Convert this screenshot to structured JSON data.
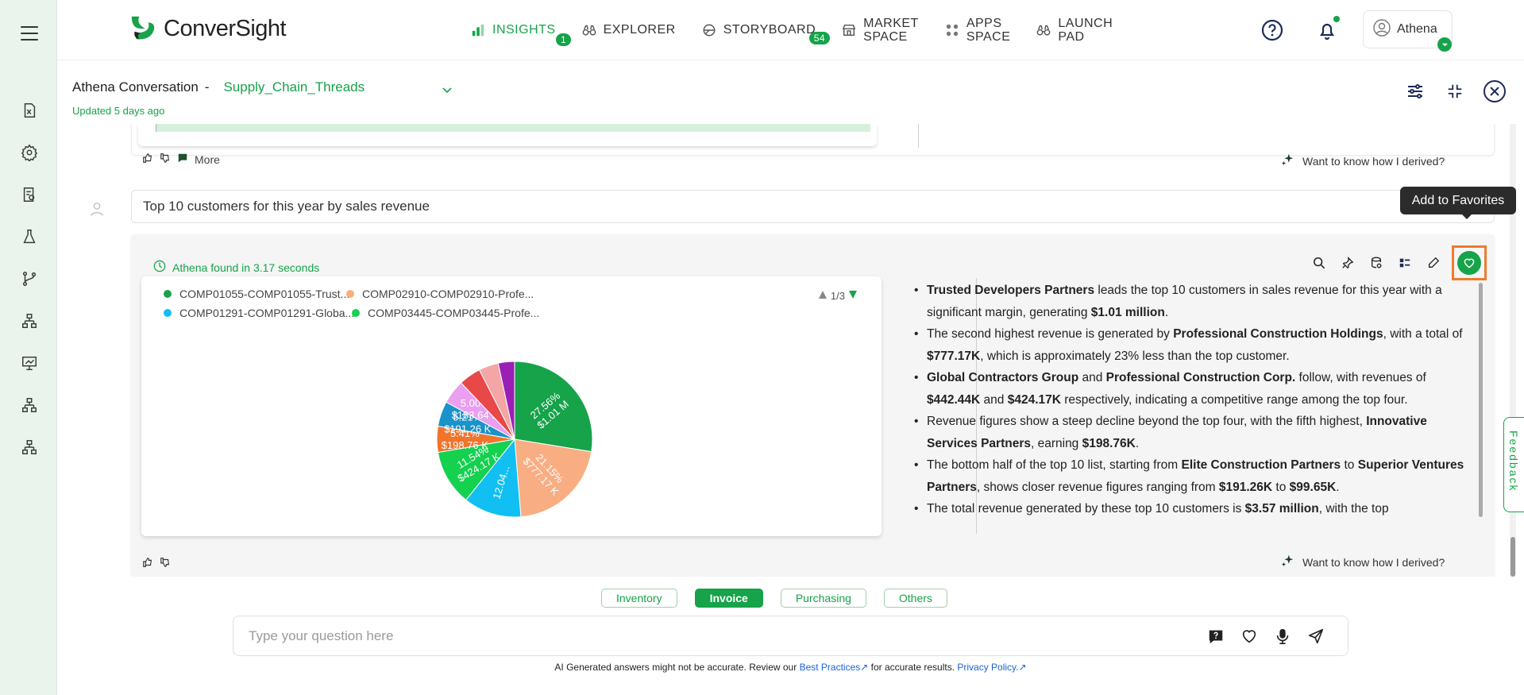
{
  "app": {
    "brand": "ConverSight"
  },
  "nav": [
    {
      "label": "INSIGHTS",
      "badge": "1",
      "active": true,
      "icon": "bar-chart-icon"
    },
    {
      "label": "EXPLORER",
      "badge": "",
      "active": false,
      "icon": "binoculars-icon"
    },
    {
      "label": "STORYBOARD",
      "badge": "54",
      "active": false,
      "icon": "palette-icon"
    },
    {
      "label_line1": "MARKET",
      "label_line2": "SPACE",
      "active": false,
      "icon": "store-icon"
    },
    {
      "label_line1": "APPS",
      "label_line2": "SPACE",
      "active": false,
      "icon": "apps-icon"
    },
    {
      "label_line1": "LAUNCH",
      "label_line2": "PAD",
      "active": false,
      "icon": "rocket-icon"
    }
  ],
  "user": {
    "name": "Athena"
  },
  "conversation": {
    "title": "Athena Conversation",
    "separator": "-",
    "dataset": "Supply_Chain_Threads",
    "updated": "Updated 5 days ago"
  },
  "previous_answer": {
    "more_label": "More",
    "derive_label": "Want to know how I derived?"
  },
  "question": {
    "text": "Top 10 customers for this year by sales revenue"
  },
  "answer": {
    "found_text": "Athena found in 3.17 seconds",
    "tooltip": "Add to Favorites",
    "legend_pager": "1/3",
    "derive_label": "Want to know how I derived?"
  },
  "chart_data": {
    "type": "pie",
    "legend_visible": [
      {
        "label": "COMP01055-COMP01055-Trust...",
        "color": "#16a34a"
      },
      {
        "label": "COMP02910-COMP02910-Profe...",
        "color": "#f9ad82"
      },
      {
        "label": "COMP01291-COMP01291-Globa...",
        "color": "#12bff2"
      },
      {
        "label": "COMP03445-COMP03445-Profe...",
        "color": "#14d14f"
      }
    ],
    "slices": [
      {
        "percent": 27.56,
        "value_label": "$1.01 M",
        "pct_label": "27.56%",
        "color": "#16a34a"
      },
      {
        "percent": 21.15,
        "value_label": "$777.17 K",
        "pct_label": "21.15%",
        "color": "#f9ad82"
      },
      {
        "percent": 12.04,
        "value_label": "",
        "pct_label": "12.04...",
        "color": "#12bff2"
      },
      {
        "percent": 11.54,
        "value_label": "$424.17 K",
        "pct_label": "11.54%",
        "color": "#14d14f"
      },
      {
        "percent": 5.41,
        "value_label": "$198.76 K",
        "pct_label": "5.41%",
        "color": "#f0742b"
      },
      {
        "percent": 5.21,
        "value_label": "$191.26 K",
        "pct_label": "5.21%",
        "color": "#1993c9"
      },
      {
        "percent": 5.0,
        "value_label": "$183.64 K",
        "pct_label": "5.00%",
        "color": "#ea9ff0"
      },
      {
        "percent": 4.6,
        "value_label": "",
        "pct_label": "",
        "color": "#e84848"
      },
      {
        "percent": 4.1,
        "value_label": "",
        "pct_label": "",
        "color": "#f4a6a6"
      },
      {
        "percent": 3.39,
        "value_label": "",
        "pct_label": "",
        "color": "#9b1fb5"
      }
    ]
  },
  "insights": [
    [
      {
        "b": "Trusted Developers Partners"
      },
      {
        "t": " leads the top 10 customers in sales revenue for this year with a significant margin, generating "
      },
      {
        "b": "$1.01 million"
      },
      {
        "t": "."
      }
    ],
    [
      {
        "t": "The second highest revenue is generated by "
      },
      {
        "b": "Professional Construction Holdings"
      },
      {
        "t": ", with a total of "
      },
      {
        "b": "$777.17K"
      },
      {
        "t": ", which is approximately 23% less than the top customer."
      }
    ],
    [
      {
        "b": "Global Contractors Group"
      },
      {
        "t": " and "
      },
      {
        "b": "Professional Construction Corp."
      },
      {
        "t": " follow, with revenues of "
      },
      {
        "b": "$442.44K"
      },
      {
        "t": " and "
      },
      {
        "b": "$424.17K"
      },
      {
        "t": " respectively, indicating a competitive range among the top four."
      }
    ],
    [
      {
        "t": "Revenue figures show a steep decline beyond the top four, with the fifth highest, "
      },
      {
        "b": "Innovative Services Partners"
      },
      {
        "t": ", earning "
      },
      {
        "b": "$198.76K"
      },
      {
        "t": "."
      }
    ],
    [
      {
        "t": "The bottom half of the top 10 list, starting from "
      },
      {
        "b": "Elite Construction Partners"
      },
      {
        "t": " to "
      },
      {
        "b": "Superior Ventures Partners"
      },
      {
        "t": ", shows closer revenue figures ranging from "
      },
      {
        "b": "$191.26K"
      },
      {
        "t": " to "
      },
      {
        "b": "$99.65K"
      },
      {
        "t": "."
      }
    ],
    [
      {
        "t": "The total revenue generated by these top 10 customers is "
      },
      {
        "b": "$3.57 million"
      },
      {
        "t": ", with the top"
      }
    ]
  ],
  "chips": [
    {
      "label": "Inventory",
      "active": false
    },
    {
      "label": "Invoice",
      "active": true
    },
    {
      "label": "Purchasing",
      "active": false
    },
    {
      "label": "Others",
      "active": false
    }
  ],
  "ask": {
    "placeholder": "Type your question here"
  },
  "disclaimer": {
    "prefix": "AI Generated answers might not be accurate. Review our ",
    "link1": "Best Practices",
    "middle": " for accurate results. ",
    "link2": "Privacy Policy."
  },
  "feedback_tab": "Feedback",
  "colors": {
    "brand": "#16a34a",
    "highlight": "#f07a2c"
  }
}
